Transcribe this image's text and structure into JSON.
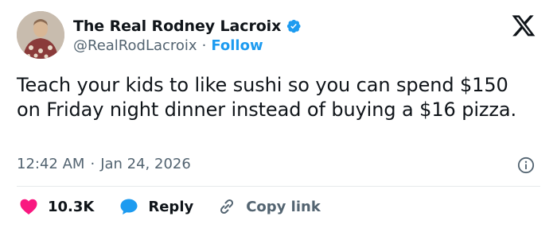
{
  "author": {
    "display_name": "The Real Rodney Lacroix",
    "handle": "@RealRodLacroix",
    "separator": "·",
    "follow_label": "Follow"
  },
  "tweet": {
    "text": "Teach your kids to like sushi so you can spend $150 on Friday night dinner instead of buying a $16 pizza.",
    "time": "12:42 AM",
    "date": "Jan 24, 2026",
    "meta_separator": "·"
  },
  "actions": {
    "like_count": "10.3K",
    "reply_label": "Reply",
    "copy_link_label": "Copy link"
  },
  "icons": {
    "brand": "x-logo-icon",
    "verified": "verified-badge-icon",
    "info": "info-icon",
    "like": "heart-icon",
    "reply": "speech-bubble-icon",
    "copy": "link-icon"
  },
  "colors": {
    "text": "#0f1419",
    "secondary": "#536471",
    "accent": "#1d9bf0",
    "like": "#f91880"
  }
}
